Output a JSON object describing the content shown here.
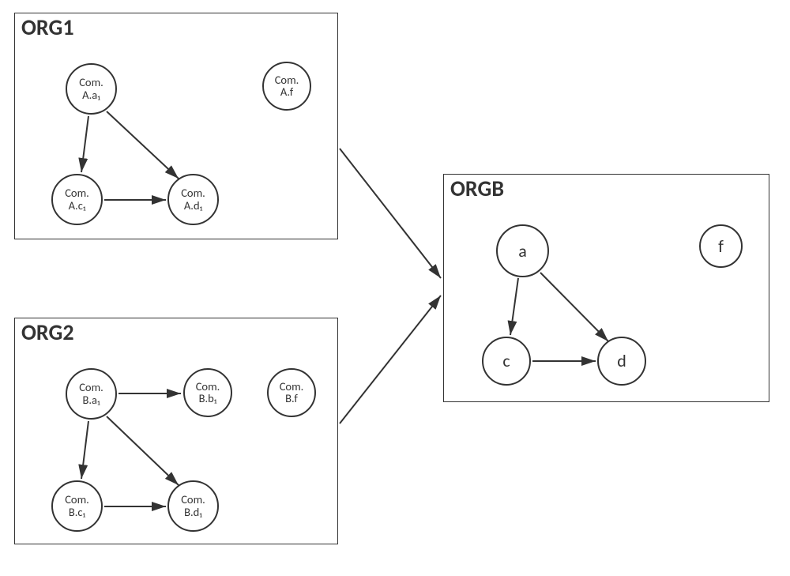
{
  "boxes": {
    "org1": {
      "title": "ORG1"
    },
    "org2": {
      "title": "ORG2"
    },
    "orgb": {
      "title": "ORGB"
    }
  },
  "nodes": {
    "org1_a": {
      "l1": "Com.",
      "l2": "A.a₁"
    },
    "org1_c": {
      "l1": "Com.",
      "l2": "A.c₁"
    },
    "org1_d": {
      "l1": "Com.",
      "l2": "A.d₁"
    },
    "org1_f": {
      "l1": "Com.",
      "l2": "A.f"
    },
    "org2_a": {
      "l1": "Com.",
      "l2": "B.a₁"
    },
    "org2_b": {
      "l1": "Com.",
      "l2": "B.b₁"
    },
    "org2_c": {
      "l1": "Com.",
      "l2": "B.c₁"
    },
    "org2_d": {
      "l1": "Com.",
      "l2": "B.d₁"
    },
    "org2_f": {
      "l1": "Com.",
      "l2": "B.f"
    },
    "orgb_a": {
      "label": "a"
    },
    "orgb_c": {
      "label": "c"
    },
    "orgb_d": {
      "label": "d"
    },
    "orgb_f": {
      "label": "f"
    }
  }
}
